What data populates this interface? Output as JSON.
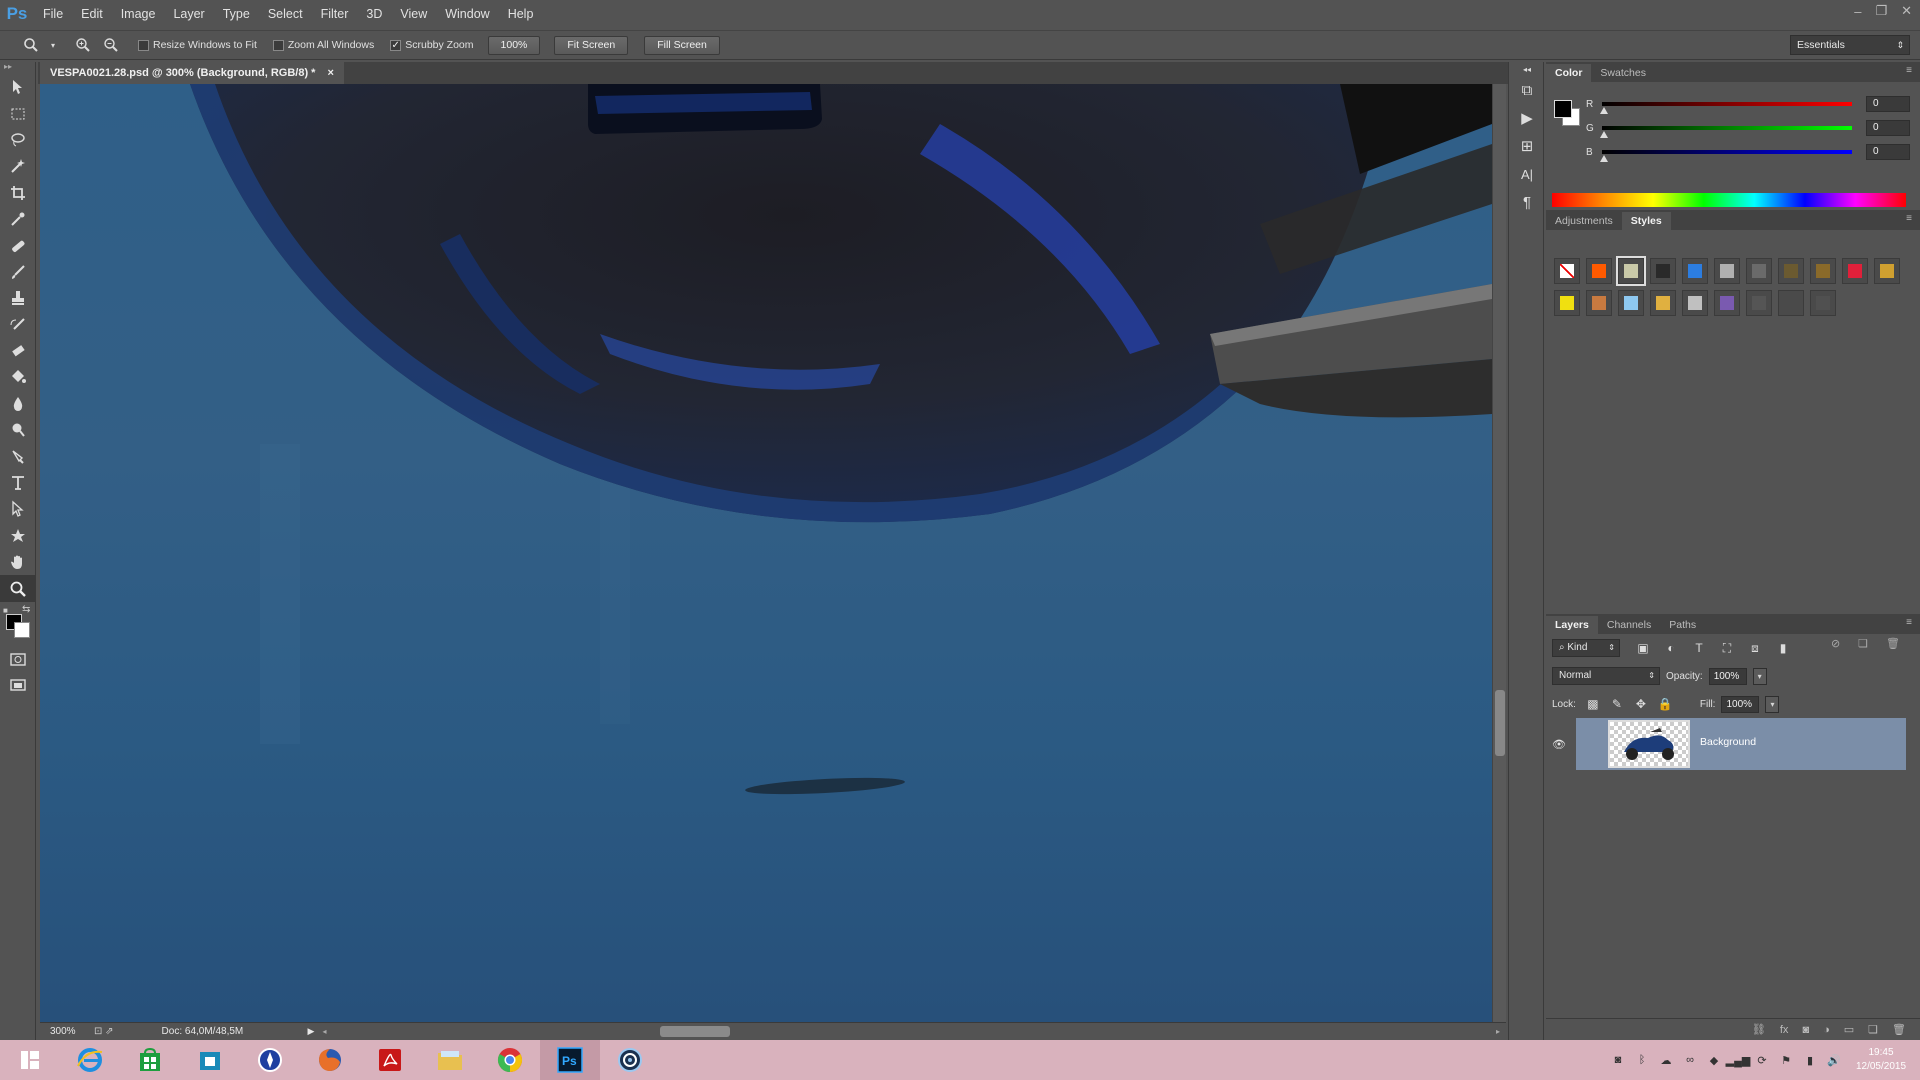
{
  "app": {
    "logo": "Ps"
  },
  "menu": [
    "File",
    "Edit",
    "Image",
    "Layer",
    "Type",
    "Select",
    "Filter",
    "3D",
    "View",
    "Window",
    "Help"
  ],
  "options_bar": {
    "resize_windows_label": "Resize Windows to Fit",
    "resize_windows_checked": false,
    "zoom_all_label": "Zoom All Windows",
    "zoom_all_checked": false,
    "scrubby_zoom_label": "Scrubby Zoom",
    "scrubby_zoom_checked": true,
    "btn_100": "100%",
    "btn_fit": "Fit Screen",
    "btn_fill": "Fill Screen",
    "workspace": "Essentials"
  },
  "document": {
    "tab_title": "VESPA0021.28.psd @ 300% (Background, RGB/8) *",
    "close": "×"
  },
  "status": {
    "zoom": "300%",
    "doc": "Doc: 64,0M/48,5M"
  },
  "color_panel": {
    "tabs": [
      "Color",
      "Swatches"
    ],
    "active_tab": "Color",
    "fg": "#000000",
    "bg": "#ffffff",
    "sliders": [
      {
        "label": "R",
        "value": "0",
        "color": "#e8222e"
      },
      {
        "label": "G",
        "value": "0",
        "color": "#2fbf2f"
      },
      {
        "label": "B",
        "value": "0",
        "color": "#2a2af0"
      }
    ]
  },
  "styles_panel": {
    "tabs": [
      "Adjustments",
      "Styles"
    ],
    "active_tab": "Styles",
    "styles": [
      "#ffffff",
      "#ff5a00",
      "#c9c9a8",
      "#2a2a2a",
      "#2c7de0",
      "#b0b0b0",
      "#6a6a6a",
      "#6b5a30",
      "#8a6a2a",
      "#e0203a",
      "#d0a030",
      "#f0e010",
      "#c87a40",
      "#8ec8f0",
      "#e0b040",
      "#c0c0c0",
      "#7a5ab0",
      "#555555",
      "#4a4a4a",
      "#505050"
    ]
  },
  "layers_panel": {
    "tabs": [
      "Layers",
      "Channels",
      "Paths"
    ],
    "active_tab": "Layers",
    "filter": "Kind",
    "blend_mode": "Normal",
    "opacity_label": "Opacity:",
    "opacity": "100%",
    "lock_label": "Lock:",
    "fill_label": "Fill:",
    "fill": "100%",
    "layers": [
      {
        "name": "Background",
        "visible": true,
        "selected": true
      }
    ]
  },
  "taskbar": {
    "apps": [
      "task-view-icon",
      "internet-explorer-icon",
      "store-icon",
      "store-bag-icon",
      "compass-icon",
      "firefox-icon",
      "acrobat-icon",
      "file-explorer-icon",
      "chrome-icon",
      "photoshop-icon",
      "lightroom-icon"
    ],
    "time": "19:45",
    "date": "12/05/2015"
  }
}
